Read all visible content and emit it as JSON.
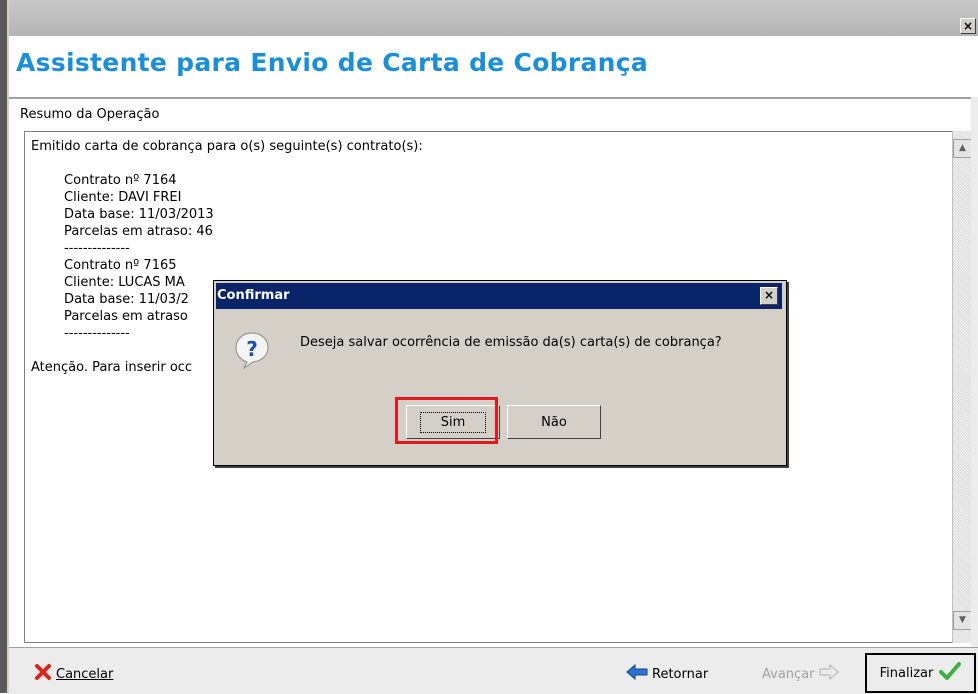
{
  "window": {
    "close_glyph": "×"
  },
  "wizard": {
    "title": "Assistente para Envio de Carta de Cobrança",
    "title_color": "#1a8fd8",
    "section_label": "Resumo da Operação",
    "summary_text": "Emitido carta de cobrança para o(s) seguinte(s) contrato(s):\n\n        Contrato nº 7164\n        Cliente: DAVI FREI\n        Data base: 11/03/2013\n        Parcelas em atraso: 46\n        --------------\n        Contrato nº 7165\n        Cliente: LUCAS MA\n        Data base: 11/03/2\n        Parcelas em atraso\n        --------------\n\nAtenção. Para inserir occ"
  },
  "scrollbar": {
    "up": "▲",
    "down": "▼"
  },
  "footer": {
    "cancel_label": "Cancelar",
    "back_label": "Retornar",
    "next_label": "Avançar",
    "finish_label": "Finalizar"
  },
  "dialog": {
    "title": "Confirmar",
    "close_glyph": "×",
    "message": "Deseja salvar ocorrência de emissão da(s) carta(s) de cobrança?",
    "yes_label": "Sim",
    "no_label": "Não",
    "title_bg": "#0a246a",
    "highlight_color": "#e0191e"
  }
}
